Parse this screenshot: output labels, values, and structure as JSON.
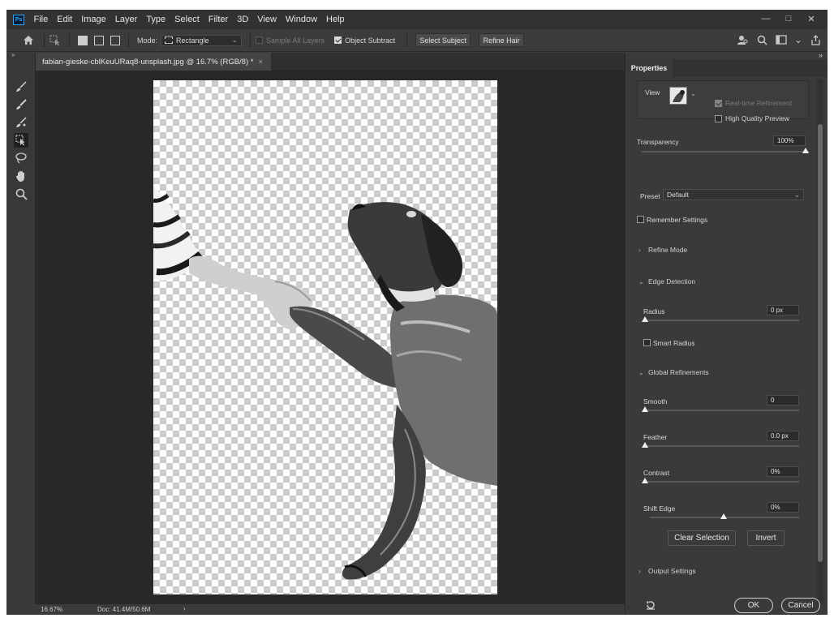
{
  "menu": [
    "File",
    "Edit",
    "Image",
    "Layer",
    "Type",
    "Select",
    "Filter",
    "3D",
    "View",
    "Window",
    "Help"
  ],
  "app_logo": "Ps",
  "window_controls": [
    "—",
    "□",
    "✕"
  ],
  "options": {
    "mode_label": "Mode:",
    "mode_value": "Rectangle",
    "sample_all_layers": "Sample All Layers",
    "object_subtract": "Object Subtract",
    "select_subject": "Select Subject",
    "refine_hair": "Refine Hair"
  },
  "document": {
    "tab_title": "fabian-gieske-cblKeuURaq8-unsplash.jpg @ 16.7% (RGB/8) *",
    "close": "×"
  },
  "status": {
    "zoom": "16.67%",
    "doc": "Doc: 41.4M/50.6M",
    "arrow": "›"
  },
  "panel": {
    "title": "Properties",
    "view_label": "View",
    "real_time_refinement": "Real-time Refinement",
    "high_quality_preview": "High Quality Preview",
    "transparency_label": "Transparency",
    "transparency_value": "100%",
    "transparency_level": 1.0,
    "preset_label": "Preset",
    "preset_value": "Default",
    "remember_settings": "Remember Settings",
    "refine_mode": "Refine Mode",
    "edge_detection": "Edge Detection",
    "radius_label": "Radius",
    "radius_value": "0 px",
    "smart_radius": "Smart Radius",
    "global_refinements": "Global Refinements",
    "smooth_label": "Smooth",
    "smooth_value": "0",
    "feather_label": "Feather",
    "feather_value": "0.0 px",
    "contrast_label": "Contrast",
    "contrast_value": "0%",
    "shift_edge_label": "Shift Edge",
    "shift_edge_value": "0%",
    "clear_selection": "Clear Selection",
    "invert": "Invert",
    "output_settings": "Output Settings",
    "ok": "OK",
    "cancel": "Cancel"
  },
  "colors": {
    "app_bg": "#3c3c3c",
    "menubar": "#323232",
    "canvas_bg": "#282828",
    "panel_bg": "#3a3a3a",
    "ps_blue": "#31a8ff"
  }
}
